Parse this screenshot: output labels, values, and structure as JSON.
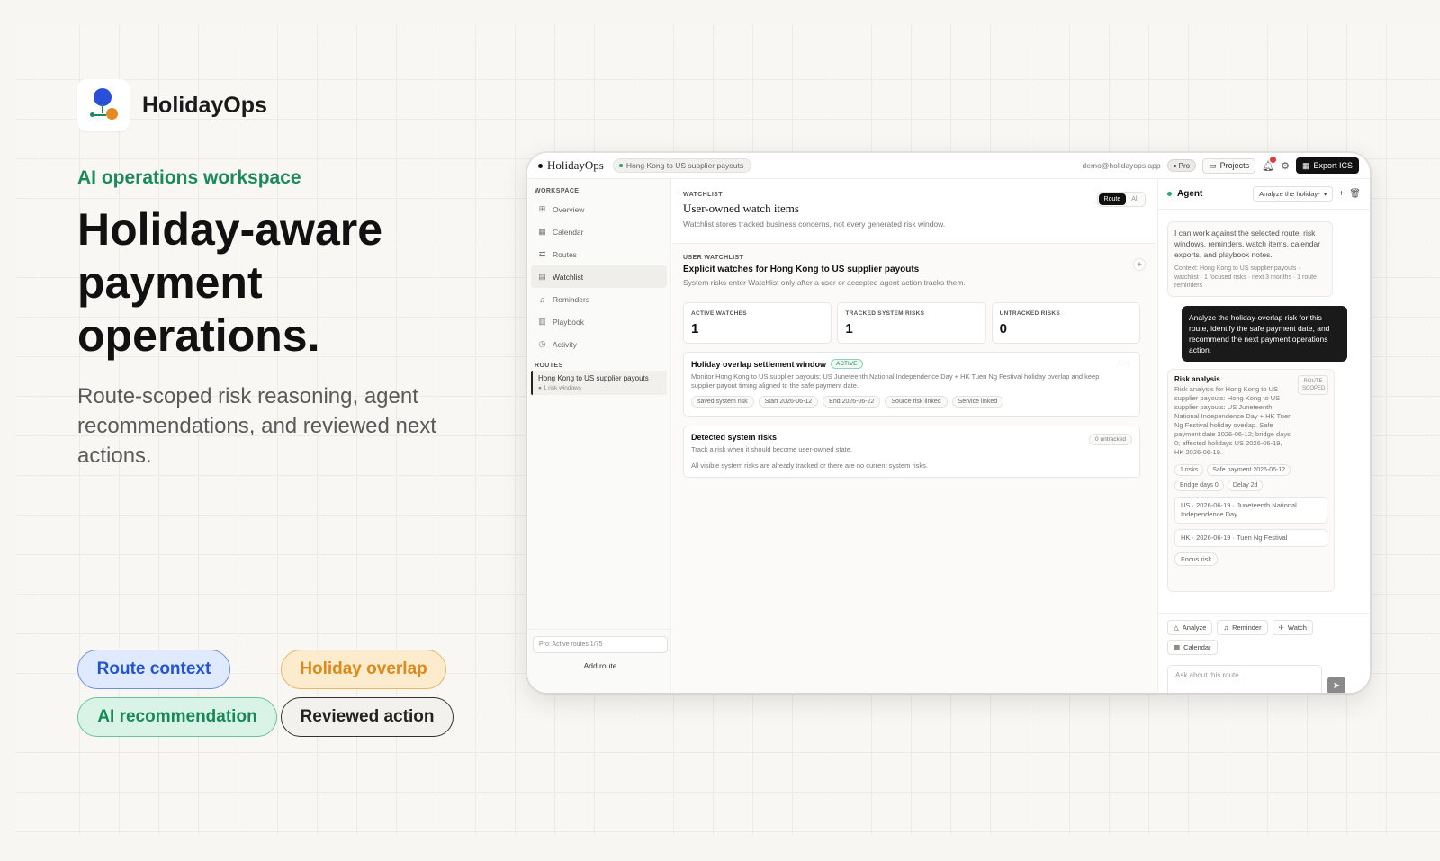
{
  "hero": {
    "brand": "HolidayOps",
    "kicker": "AI operations workspace",
    "title": "Holiday-aware payment operations.",
    "subtitle": "Route-scoped risk reasoning, agent recommendations, and reviewed next actions.",
    "chips": [
      "Route context",
      "Holiday overlap",
      "AI recommendation",
      "Reviewed action"
    ]
  },
  "topbar": {
    "brand": "HolidayOps",
    "route": "Hong Kong to US supplier payouts",
    "email": "demo@holidayops.app",
    "plan": "Pro",
    "projects": "Projects",
    "export": "Export ICS"
  },
  "sidebar": {
    "workspace_label": "WORKSPACE",
    "items": [
      {
        "icon": "grid-icon",
        "label": "Overview"
      },
      {
        "icon": "calendar-icon",
        "label": "Calendar"
      },
      {
        "icon": "route-icon",
        "label": "Routes"
      },
      {
        "icon": "bookmark-icon",
        "label": "Watchlist"
      },
      {
        "icon": "bell-icon",
        "label": "Reminders"
      },
      {
        "icon": "book-icon",
        "label": "Playbook"
      },
      {
        "icon": "clock-icon",
        "label": "Activity"
      }
    ],
    "routes_label": "ROUTES",
    "route_item": {
      "title": "Hong Kong to US supplier payouts",
      "sub": "1 risk windows"
    },
    "plan_status": "Pro: Active routes 1/75",
    "add_route": "Add route"
  },
  "main": {
    "kicker": "WATCHLIST",
    "title": "User-owned watch items",
    "desc": "Watchlist stores tracked business concerns, not every generated risk window.",
    "seg_on": "Route",
    "seg_off": "All",
    "uw_kicker": "USER WATCHLIST",
    "uw_title": "Explicit watches for Hong Kong to US supplier payouts",
    "uw_desc": "System risks enter Watchlist only after a user or accepted agent action tracks them.",
    "stats": [
      {
        "label": "ACTIVE WATCHES",
        "value": "1"
      },
      {
        "label": "TRACKED SYSTEM RISKS",
        "value": "1"
      },
      {
        "label": "UNTRACKED RISKS",
        "value": "0"
      }
    ],
    "watch_card": {
      "title": "Holiday overlap settlement window",
      "badge": "ACTIVE",
      "text": "Monitor Hong Kong to US supplier payouts: US Juneteenth National Independence Day + HK Tuen Ng Festival holiday overlap and keep supplier payout timing aligned to the safe payment date.",
      "tags": [
        "saved system risk",
        "Start 2026-06-12",
        "End 2026-06-22",
        "Source risk linked",
        "Service linked"
      ]
    },
    "risk_card": {
      "title": "Detected system risks",
      "desc": "Track a risk when it should become user-owned state.",
      "badge": "0 untracked",
      "note": "All visible system risks are already tracked or there are no current system risks."
    }
  },
  "agent": {
    "title": "Agent",
    "select": "Analyze the holiday-",
    "intro": "I can work against the selected route, risk windows, reminders, watch items, calendar exports, and playbook notes.",
    "context": "Context: Hong Kong to US supplier payouts · watchlist · 1 focused risks · next 3 months · 1 route reminders",
    "user_msg": "Analyze the holiday-overlap risk for this route, identify the safe payment date, and recommend the next payment operations action.",
    "result_title": "Risk analysis",
    "result_scope": "ROUTE SCOPED",
    "result_body": "Risk analysis for Hong Kong to US supplier payouts: Hong Kong to US supplier payouts: US Juneteenth National Independence Day + HK Tuen Ng Festival holiday overlap. Safe payment date 2026-06-12; bridge days 0; affected holidays US 2026-06-19, HK 2026-06-19.",
    "tags": [
      "1 risks",
      "Safe payment 2026-06-12",
      "Bridge days 0",
      "Delay 2d"
    ],
    "holidays": [
      "US · 2026-06-19 · Juneteenth National Independence Day",
      "HK · 2026-06-19 · Tuen Ng Festival"
    ],
    "focus": "Focus risk",
    "actions": [
      "Analyze",
      "Reminder",
      "Watch",
      "Calendar"
    ],
    "input_placeholder": "Ask about this route..."
  }
}
